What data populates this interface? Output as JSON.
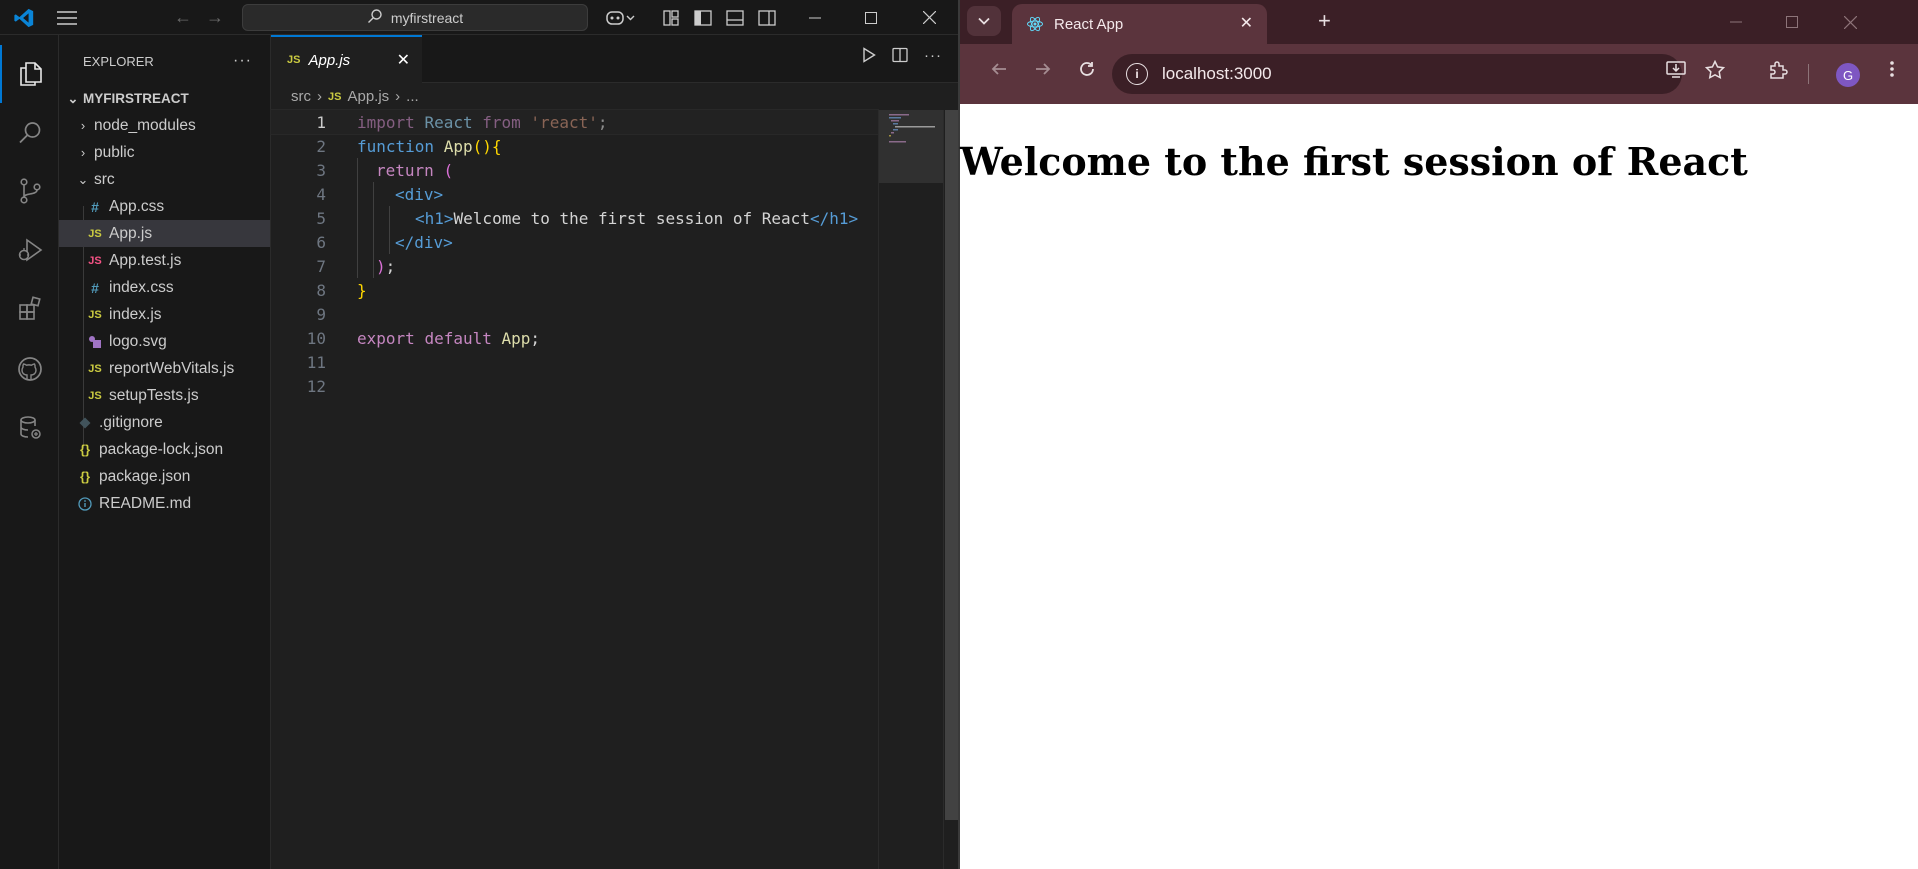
{
  "vscode": {
    "command_center": "myfirstreact",
    "explorer_title": "EXPLORER",
    "folder_name": "MYFIRSTREACT",
    "tree": [
      {
        "label": "node_modules",
        "kind": "folder",
        "icon": "chevron-right-icon"
      },
      {
        "label": "public",
        "kind": "folder",
        "icon": "chevron-right-icon"
      },
      {
        "label": "src",
        "kind": "folder",
        "icon": "chevron-down-icon"
      },
      {
        "label": "App.css",
        "kind": "css-file",
        "badge": "#"
      },
      {
        "label": "App.js",
        "kind": "js-file",
        "badge": "JS",
        "selected": true
      },
      {
        "label": "App.test.js",
        "kind": "test-file",
        "badge": "JS"
      },
      {
        "label": "index.css",
        "kind": "css-file",
        "badge": "#"
      },
      {
        "label": "index.js",
        "kind": "js-file",
        "badge": "JS"
      },
      {
        "label": "logo.svg",
        "kind": "svg-file",
        "badge": "svg"
      },
      {
        "label": "reportWebVitals.js",
        "kind": "js-file",
        "badge": "JS"
      },
      {
        "label": "setupTests.js",
        "kind": "js-file",
        "badge": "JS"
      },
      {
        "label": ".gitignore",
        "kind": "git-file",
        "badge": "git"
      },
      {
        "label": "package-lock.json",
        "kind": "json-file",
        "badge": "{}"
      },
      {
        "label": "package.json",
        "kind": "json-file",
        "badge": "{}"
      },
      {
        "label": "README.md",
        "kind": "info-file",
        "badge": "i"
      }
    ],
    "tab_label": "App.js",
    "tab_badge": "JS",
    "breadcrumb": {
      "folder": "src",
      "file": "App.js",
      "more": "..."
    },
    "line_numbers": [
      "1",
      "2",
      "3",
      "4",
      "5",
      "6",
      "7",
      "8",
      "9",
      "10",
      "11",
      "12"
    ],
    "code": {
      "l1_import": "import",
      "l1_react": "React",
      "l1_from": "from",
      "l1_str": "'react'",
      "l1_semi": ";",
      "l2_function": "function",
      "l2_name": "App",
      "l2_paren": "()",
      "l2_brace": "{",
      "l3_return": "return",
      "l3_paren": "(",
      "l4_open": "<div>",
      "l5_h1_open": "<h1>",
      "l5_text": "Welcome to the first session of React",
      "l5_h1_close": "</h1>",
      "l6_close": "</div>",
      "l7_paren": ")",
      "l7_semi": ";",
      "l8_brace": "}",
      "l10_export": "export",
      "l10_default": "default",
      "l10_app": "App",
      "l10_semi": ";"
    },
    "colors": {
      "accent": "#0078d4",
      "keyword": "#c586c0",
      "string": "#ce9178",
      "function": "#dcdcaa",
      "tag": "#569cd6"
    }
  },
  "chrome": {
    "tab_title": "React App",
    "url": "localhost:3000",
    "avatar_letter": "G",
    "page_heading": "Welcome to the first session of React",
    "colors": {
      "frame": "#3b1f26",
      "toolbar": "#5b343d",
      "avatar": "#7e57c2"
    }
  }
}
